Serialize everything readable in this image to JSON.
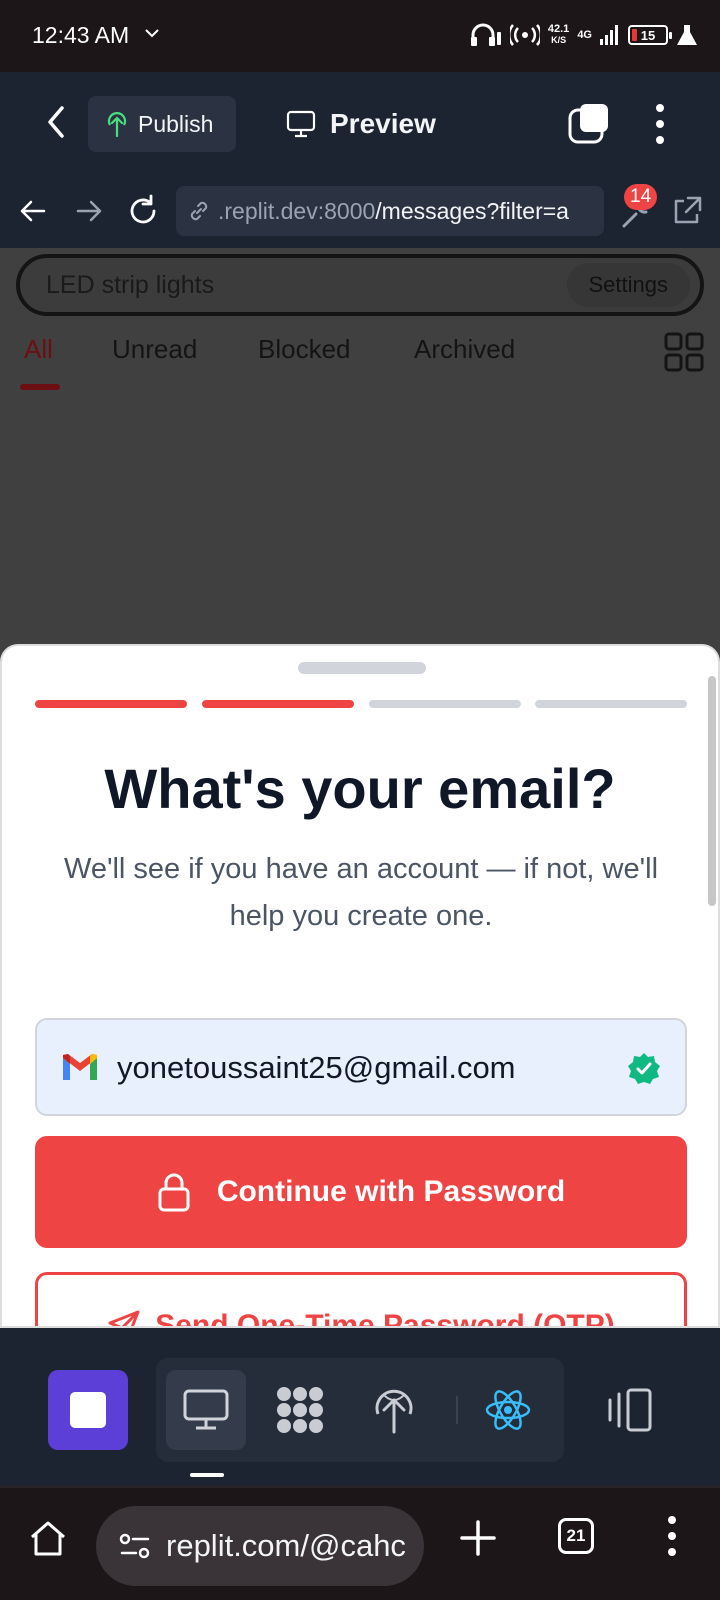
{
  "status_bar": {
    "time": "12:43 AM",
    "net_speed_value": "42.1",
    "net_speed_unit": "K/S",
    "network": "4G",
    "battery": "15"
  },
  "toolbar": {
    "publish_label": "Publish",
    "preview_label": "Preview"
  },
  "url_bar": {
    "host": ".replit.dev:8000",
    "path": "/messages?filter=a",
    "badge_count": "14"
  },
  "app": {
    "search_text": "LED strip lights",
    "settings_label": "Settings",
    "tabs": [
      {
        "label": "All",
        "active": true
      },
      {
        "label": "Unread",
        "active": false
      },
      {
        "label": "Blocked",
        "active": false
      },
      {
        "label": "Archived",
        "active": false
      }
    ]
  },
  "sheet": {
    "progress_steps": 4,
    "progress_completed": 2,
    "title": "What's your email?",
    "subtitle": "We'll see if you have an account — if not, we'll help you create one.",
    "email_value": "yonetoussaint25@gmail.com",
    "password_button_label": "Continue with Password",
    "otp_button_label": "Send One-Time Password (OTP)"
  },
  "dock": {
    "items": [
      "stop-icon",
      "monitor-icon",
      "extensions-icon",
      "deploy-icon",
      "react-icon",
      "panel-icon"
    ]
  },
  "browser_bar": {
    "url": "replit.com/@cahc",
    "tab_count": "21"
  },
  "colors": {
    "accent_red": "#ef4444",
    "replit_purple": "#5b3fd6",
    "verified_green": "#10b981"
  }
}
